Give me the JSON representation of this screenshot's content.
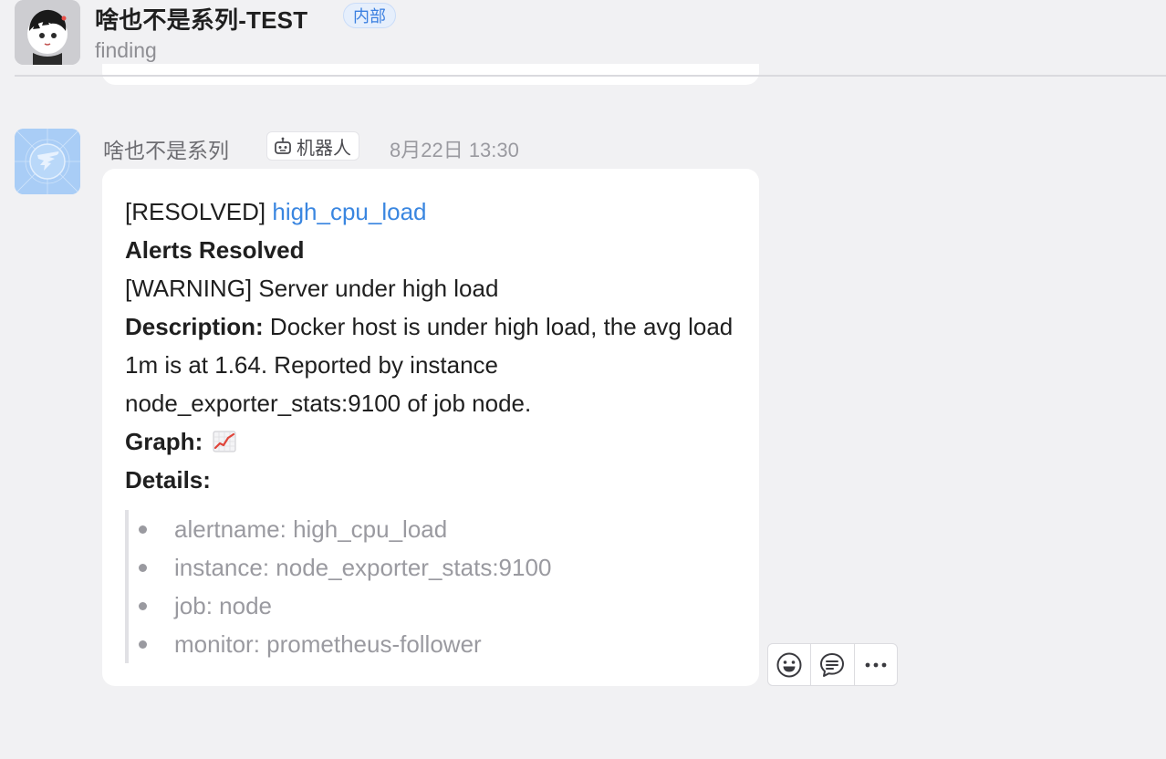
{
  "header": {
    "group_name": "啥也不是系列-TEST",
    "tag": "内部",
    "subtitle": "finding",
    "avatar_icon": "anime-character-avatar"
  },
  "message": {
    "sender": "啥也不是系列",
    "bot_badge": "机器人",
    "bot_icon": "robot-icon",
    "timestamp": "8月22日 13:30",
    "avatar_icon": "dingtalk-logo",
    "content": {
      "status_prefix": "[RESOLVED]",
      "alert_link": "high_cpu_load",
      "heading": "Alerts Resolved",
      "warning": "[WARNING] Server under high load",
      "description_label": "Description:",
      "description_text": "Docker host is under high load, the avg load 1m is at 1.64. Reported by instance node_exporter_stats:9100 of job node.",
      "graph_label": "Graph:",
      "graph_icon": "chart-increasing-emoji",
      "details_label": "Details:",
      "details": [
        "alertname: high_cpu_load",
        "instance: node_exporter_stats:9100",
        "job: node",
        "monitor: prometheus-follower"
      ]
    }
  },
  "actions": [
    {
      "name": "emoji-reaction",
      "icon": "smile-icon"
    },
    {
      "name": "reply",
      "icon": "comment-icon"
    },
    {
      "name": "more",
      "icon": "more-icon"
    }
  ],
  "colors": {
    "background": "#f1f1f3",
    "link": "#3a86e0",
    "tag_text": "#3a7fe0",
    "bubble": "#ffffff",
    "muted": "#9a9aa0"
  }
}
